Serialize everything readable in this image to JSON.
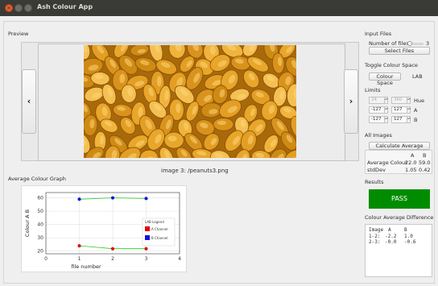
{
  "window": {
    "title": "Ash Colour App"
  },
  "preview": {
    "section_label": "Preview",
    "prev_glyph": "‹",
    "next_glyph": "›",
    "caption": "image 3: /peanuts3.png"
  },
  "graph": {
    "section_label": "Average Colour Graph"
  },
  "chart_data": {
    "type": "scatter",
    "title": "",
    "xlabel": "file number",
    "ylabel": "Colour A B",
    "xlim": [
      0,
      4
    ],
    "ylim": [
      18,
      64
    ],
    "x_ticks": [
      "0",
      "1",
      "2",
      "3",
      "4"
    ],
    "y_ticks": [
      "20",
      "30",
      "40",
      "50",
      "60"
    ],
    "grid": true,
    "legend_title": "LAB Legend",
    "legend_position": "right",
    "series": [
      {
        "name": "A Channel",
        "color": "#e60000",
        "line_color": "#22cc22",
        "x": [
          1,
          2,
          3
        ],
        "y": [
          24.0,
          21.8,
          21.8
        ]
      },
      {
        "name": "B Channel",
        "color": "#1010e0",
        "line_color": "#22cc22",
        "x": [
          1,
          2,
          3
        ],
        "y": [
          59.0,
          60.0,
          59.5
        ]
      }
    ]
  },
  "input_files": {
    "section_label": "Input Files",
    "num_files_label": "Number of files",
    "num_files_value": "3",
    "slider_fraction": 0.0,
    "select_button": "Select Files"
  },
  "toggle_colour": {
    "section_label": "Toggle Colour Space",
    "button": "Colour Space",
    "current_space": "LAB"
  },
  "limits": {
    "section_label": "Limits",
    "rows": [
      {
        "min": "24",
        "max": "360",
        "label": "Hue",
        "disabled": true
      },
      {
        "min": "-127",
        "max": "127",
        "label": "A",
        "disabled": false
      },
      {
        "min": "-127",
        "max": "127",
        "label": "B",
        "disabled": false
      }
    ]
  },
  "all_images": {
    "section_label": "All Images",
    "calc_button": "Calculate Average",
    "col_a": "A",
    "col_b": "B",
    "avg_label": "Average Colour",
    "avg_a": "22.0",
    "avg_b": "59.0",
    "std_label": "stdDev",
    "std_a": "1.05",
    "std_b": "0.42"
  },
  "results": {
    "section_label": "Results",
    "status": "PASS",
    "status_color": "#008c00"
  },
  "diff": {
    "section_label": "Colour Average Difference",
    "header": [
      "Image",
      "A",
      "B"
    ],
    "rows": [
      [
        "1-2:",
        "-2.2",
        "1.0"
      ],
      [
        "2-3:",
        "-0.0",
        "-0.6"
      ]
    ]
  }
}
